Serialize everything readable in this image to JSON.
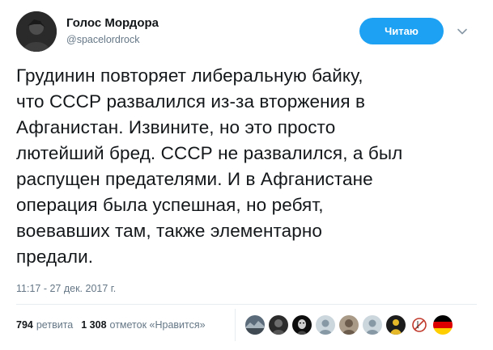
{
  "author": {
    "name": "Голос Мордора",
    "handle": "@spacelordrock"
  },
  "follow_button": {
    "label": "Читаю",
    "color": "#1da1f2"
  },
  "tweet": {
    "text": "Грудинин повторяет либеральную байку,\nчто СССР развалился из-за вторжения в\nАфганистан. Извините, но это просто\nлютейший бред. СССР не развалился, а был\nраспущен предателями. И в Афганистане\nоперация была успешная, но ребят,\nвоевавших там, также элементарно\nпредали.",
    "timestamp": "11:17 - 27 дек. 2017 г."
  },
  "stats": {
    "retweets_count": "794",
    "retweets_label": "ретвита",
    "likes_count": "1 308",
    "likes_label": "отметок «Нравится»"
  },
  "likers": [
    {
      "icon": "landscape-avatar",
      "bg": "#5b6b7a",
      "fg": "#a7b3bd"
    },
    {
      "icon": "dark-figure-avatar",
      "bg": "#2b2b2b",
      "fg": "#6d6d6d"
    },
    {
      "icon": "black-mask-avatar",
      "bg": "#0d0d0d",
      "fg": "#cfcfcf"
    },
    {
      "icon": "default-egg-avatar",
      "bg": "#ccd6dd",
      "fg": "#8899a6"
    },
    {
      "icon": "person-photo-avatar",
      "bg": "#a89a86",
      "fg": "#6b5c4c"
    },
    {
      "icon": "default-egg-avatar",
      "bg": "#ccd6dd",
      "fg": "#8899a6"
    },
    {
      "icon": "yellow-figure-avatar",
      "bg": "#1c1c1c",
      "fg": "#e5b82a"
    },
    {
      "icon": "crossed-circle-avatar",
      "bg": "#ffffff",
      "fg": "#c0392b"
    },
    {
      "icon": "german-flag-avatar",
      "bg": "#dd0000",
      "fg": "#ffce00"
    }
  ]
}
